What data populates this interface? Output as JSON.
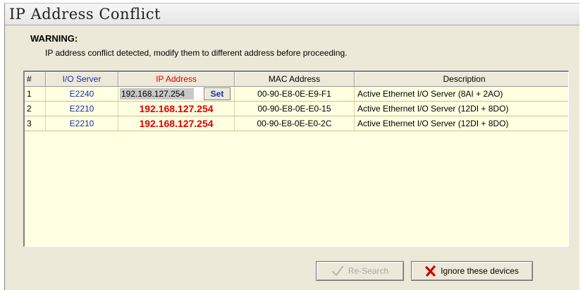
{
  "window": {
    "title": "IP Address Conflict"
  },
  "warning": {
    "heading": "WARNING:",
    "message": "IP address conflict detected, modify them to different address before proceeding."
  },
  "table": {
    "columns": [
      "#",
      "I/O Server",
      "IP Address",
      "MAC Address",
      "Description"
    ],
    "column_colors": {
      "io_server": "#1a2fb0",
      "ip_address": "#e00000"
    },
    "rows": [
      {
        "num": "1",
        "server": "E2240",
        "ip": "192.168.127.254",
        "mac": "00-90-E8-0E-E9-F1",
        "description": "Active Ethernet I/O Server (8AI + 2AO)",
        "editing": true
      },
      {
        "num": "2",
        "server": "E2210",
        "ip": "192.168.127.254",
        "mac": "00-90-E8-0E-E0-15",
        "description": "Active Ethernet I/O Server (12DI + 8DO)"
      },
      {
        "num": "3",
        "server": "E2210",
        "ip": "192.168.127.254",
        "mac": "00-90-E8-0E-E0-2C",
        "description": "Active Ethernet I/O Server (12DI + 8DO)"
      }
    ],
    "set_label": "Set"
  },
  "buttons": {
    "research_label": "Re-Search",
    "research_enabled": false,
    "research_icon": "checkmark-icon",
    "ignore_label": "Ignore these devices",
    "ignore_icon": "red-x-icon"
  },
  "colors": {
    "background": "#ece9d8",
    "table_background": "#ffffe1",
    "conflict_red": "#e00000",
    "server_blue": "#1a2fb0"
  }
}
